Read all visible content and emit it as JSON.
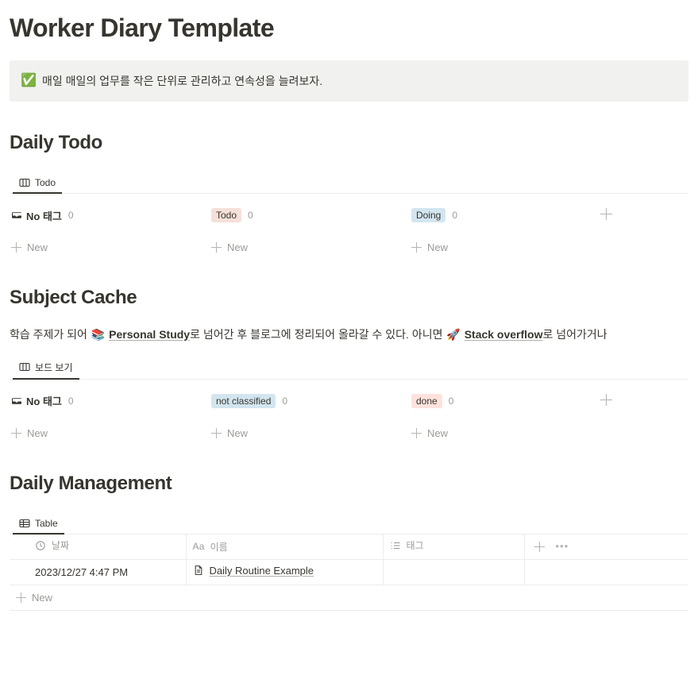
{
  "page": {
    "title": "Worker Diary Template",
    "callout": {
      "emoji": "✅",
      "text": "매일 매일의 업무를 작은 단위로 관리하고 연속성을 늘려보자."
    }
  },
  "daily_todo": {
    "heading": "Daily Todo",
    "view_tab": {
      "label": "Todo",
      "icon": "board-icon"
    },
    "groups": [
      {
        "name": "No 태그",
        "count": "0",
        "style": "no-tag",
        "new_label": "New"
      },
      {
        "name": "Todo",
        "count": "0",
        "style": "pill",
        "pill_bg": "#f5e0d9",
        "pill_color": "#37352f",
        "new_label": "New"
      },
      {
        "name": "Doing",
        "count": "0",
        "style": "pill",
        "pill_bg": "#d3e5ef",
        "pill_color": "#37352f",
        "new_label": "New"
      }
    ],
    "add_group_label": "+"
  },
  "subject_cache": {
    "heading": "Subject Cache",
    "description": {
      "part1": "학습 주제가 되어 ",
      "emoji1": "📚",
      "link1": "Personal Study",
      "part2": "로 넘어간 후 블로그에 정리되어 올라갈 수 있다. 아니면 ",
      "emoji2": "🚀",
      "link2": "Stack overflow",
      "part3": "로 넘어가거나"
    },
    "view_tab": {
      "label": "보드 보기",
      "icon": "board-icon"
    },
    "groups": [
      {
        "name": "No 태그",
        "count": "0",
        "style": "no-tag",
        "new_label": "New"
      },
      {
        "name": "not classified",
        "count": "0",
        "style": "pill",
        "pill_bg": "#d3e5ef",
        "pill_color": "#37352f",
        "new_label": "New"
      },
      {
        "name": "done",
        "count": "0",
        "style": "pill",
        "pill_bg": "#ffe2dd",
        "pill_color": "#37352f",
        "new_label": "New"
      }
    ],
    "add_group_label": "+"
  },
  "daily_management": {
    "heading": "Daily Management",
    "view_tab": {
      "label": "Table",
      "icon": "table-icon"
    },
    "columns": [
      {
        "label": "날짜",
        "icon": "clock-icon"
      },
      {
        "label": "이름",
        "icon": "aa-icon"
      },
      {
        "label": "태그",
        "icon": "multi-select-icon"
      }
    ],
    "add_column_label": "+",
    "more_label": "•••",
    "rows": [
      {
        "date": "2023/12/27 4:47 PM",
        "name": "Daily Routine Example",
        "tag": ""
      }
    ],
    "new_row_label": "New"
  }
}
